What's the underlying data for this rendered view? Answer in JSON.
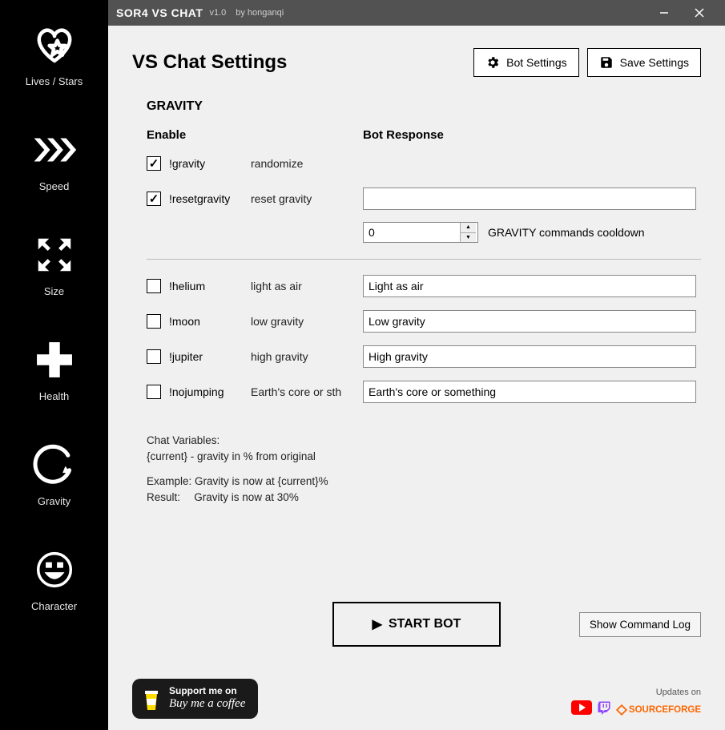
{
  "titlebar": {
    "app_title": "SOR4 VS CHAT",
    "version": "v1.0",
    "author": "by honganqi"
  },
  "sidebar": {
    "items": [
      {
        "label": "Lives / Stars"
      },
      {
        "label": "Speed"
      },
      {
        "label": "Size"
      },
      {
        "label": "Health"
      },
      {
        "label": "Gravity"
      },
      {
        "label": "Character"
      }
    ]
  },
  "header": {
    "page_title": "VS Chat Settings",
    "bot_settings": "Bot Settings",
    "save_settings": "Save Settings"
  },
  "section": {
    "title": "GRAVITY",
    "col_enable": "Enable",
    "col_response": "Bot Response"
  },
  "commands": {
    "gravity": {
      "checked": true,
      "cmd": "!gravity",
      "desc": "randomize",
      "response": null
    },
    "resetgravity": {
      "checked": true,
      "cmd": "!resetgravity",
      "desc": "reset gravity",
      "response": ""
    },
    "helium": {
      "checked": false,
      "cmd": "!helium",
      "desc": "light as air",
      "response": "Light as air"
    },
    "moon": {
      "checked": false,
      "cmd": "!moon",
      "desc": "low gravity",
      "response": "Low gravity"
    },
    "jupiter": {
      "checked": false,
      "cmd": "!jupiter",
      "desc": "high gravity",
      "response": "High gravity"
    },
    "nojumping": {
      "checked": false,
      "cmd": "!nojumping",
      "desc": "Earth's core or sth",
      "response": "Earth's core or something"
    }
  },
  "cooldown": {
    "value": "0",
    "label": "GRAVITY commands cooldown"
  },
  "vars": {
    "l1": "Chat Variables:",
    "l2": "{current} - gravity in % from original",
    "l3": "Example: Gravity is now at {current}%",
    "l4": "Result:  Gravity is now at 30%"
  },
  "actions": {
    "start_bot": "START BOT",
    "show_log": "Show Command Log"
  },
  "footer": {
    "bmac_l1": "Support me on",
    "bmac_l2": "Buy me a coffee",
    "updates_label": "Updates on",
    "sourceforge": "SOURCEFORGE"
  }
}
